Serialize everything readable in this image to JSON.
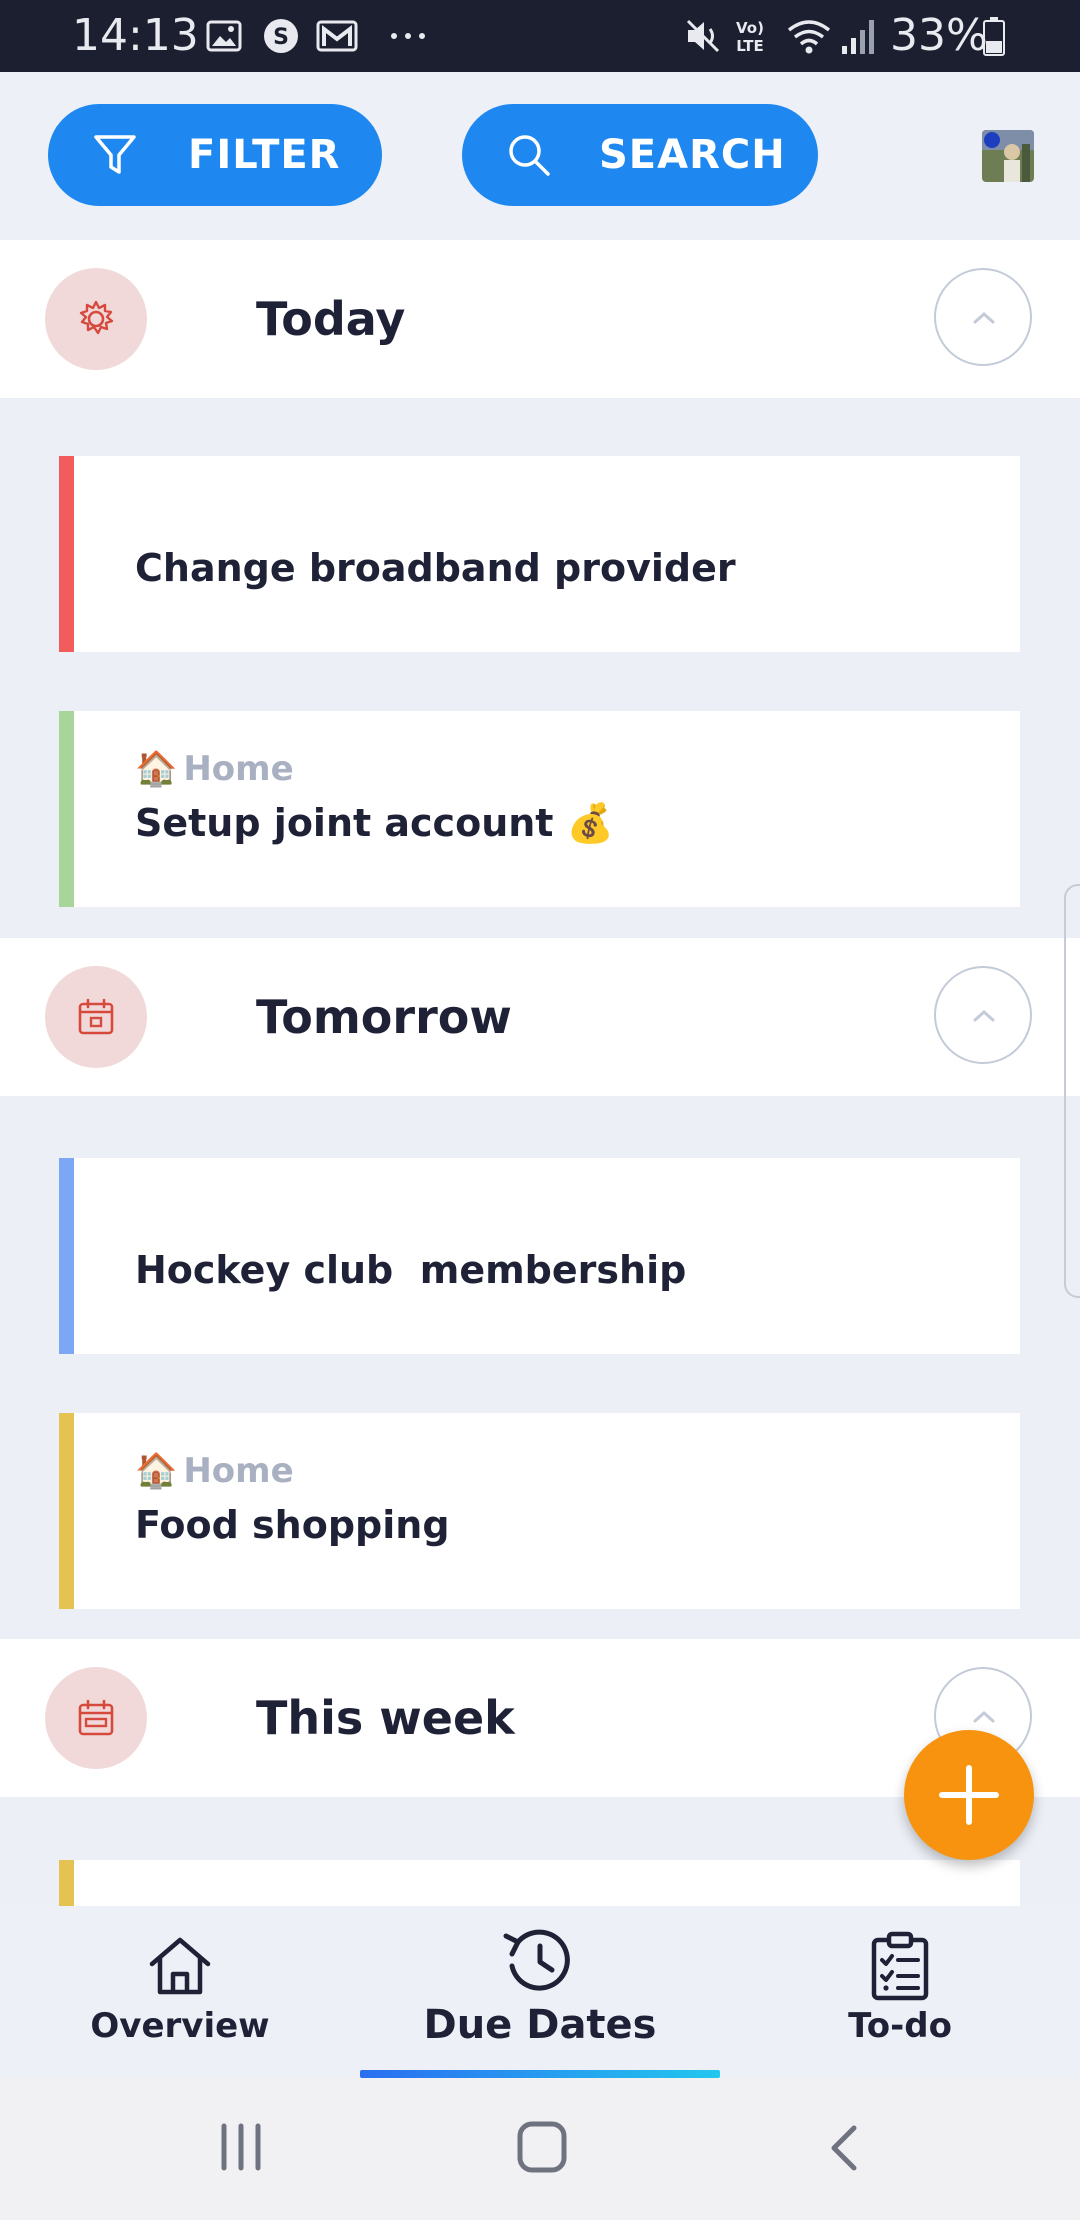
{
  "status_bar": {
    "time": "14:13",
    "battery": "33%",
    "icons": [
      "gallery-icon",
      "skype-icon",
      "gmail-icon",
      "more-dots-icon",
      "mute-icon",
      "volte-icon",
      "wifi-icon",
      "signal-icon",
      "battery-icon"
    ]
  },
  "topbar": {
    "filter_label": "FILTER",
    "search_label": "SEARCH",
    "accent": "#1e88f0"
  },
  "sections": [
    {
      "title": "Today",
      "icon": "sun-icon",
      "tasks": [
        {
          "title": "Change broadband provider",
          "category": "",
          "color": "#f25c5c"
        },
        {
          "title": "Setup joint account 💰",
          "category": "Home",
          "category_emoji": "🏠",
          "color": "#a8d59a"
        }
      ]
    },
    {
      "title": "Tomorrow",
      "icon": "calendar-icon",
      "tasks": [
        {
          "title": "Hockey club  membership",
          "category": "",
          "color": "#7ba7f5"
        },
        {
          "title": "Food shopping",
          "category": "Home",
          "category_emoji": "🏠",
          "color": "#e5c353"
        }
      ]
    },
    {
      "title": "This week",
      "icon": "calendar-week-icon",
      "tasks": [
        {
          "title": "",
          "category": "",
          "color": "#e5c353"
        }
      ]
    }
  ],
  "fab": {
    "icon": "plus-icon",
    "color": "#f7930f"
  },
  "bottom_nav": {
    "items": [
      {
        "label": "Overview",
        "icon": "home-icon"
      },
      {
        "label": "Due Dates",
        "icon": "history-icon",
        "selected": true
      },
      {
        "label": "To-do",
        "icon": "clipboard-checklist-icon"
      }
    ]
  },
  "system_nav": [
    "recents-icon",
    "home-button-icon",
    "back-icon"
  ]
}
